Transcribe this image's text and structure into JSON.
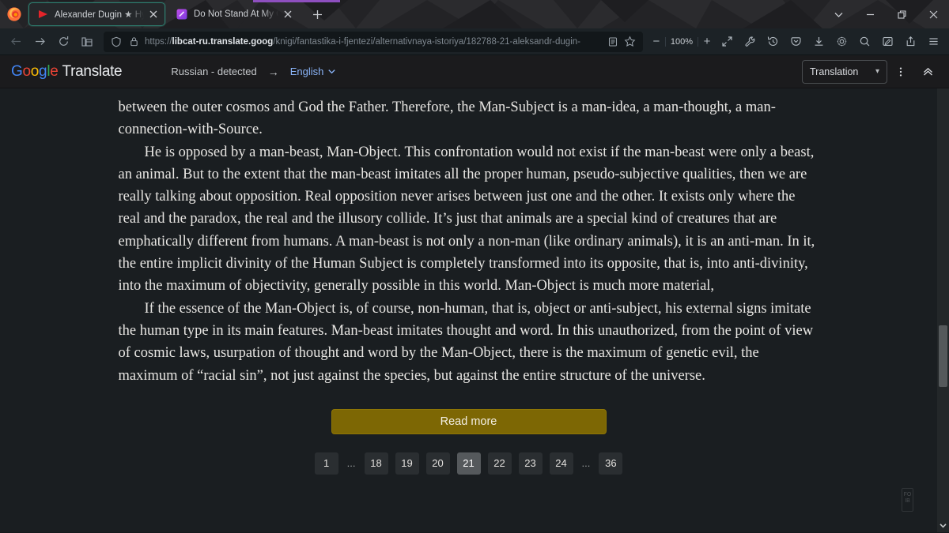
{
  "window": {
    "controls": {
      "list_tabs": "list-all-tabs",
      "minimize": "minimize",
      "maximize": "restore",
      "close": "close"
    }
  },
  "tabs": [
    {
      "title": "Alexander Dugin ★ Hyperborea",
      "favicon": "red-triangle-icon",
      "active": true,
      "close_label": "✕"
    },
    {
      "title": "Do Not Stand At My Grave And",
      "favicon": "purple-square-icon",
      "active": false,
      "close_label": "✕"
    }
  ],
  "newtab": {
    "label": "+",
    "tooltip": "New tab"
  },
  "navbar": {
    "back": "back-arrow",
    "forward": "forward-arrow",
    "reload": "reload-icon",
    "library": "library-icon",
    "url": {
      "scheme": "https://",
      "domain": "libcat-ru.translate.goog",
      "path": "/knigi/fantastika-i-fjentezi/alternativnaya-istoriya/182788-21-aleksandr-dugin-",
      "full": "https://libcat-ru.translate.goog/knigi/fantastika-i-fjentezi/alternativnaya-istoriya/182788-21-aleksandr-dugin-"
    },
    "shield": "shield-icon",
    "lock": "lock-icon",
    "reader": "reader-view-icon",
    "bookmark": "star-icon",
    "zoom_out": "−",
    "zoom_level": "100%",
    "zoom_in": "+",
    "icons": [
      "fullscreen-expand-icon",
      "wrench-icon",
      "history-icon",
      "pocket-icon",
      "download-icon",
      "gear-icon",
      "search-icon",
      "annotate-icon",
      "share-icon",
      "hamburger-menu-icon"
    ]
  },
  "translate_bar": {
    "logo": {
      "google": "Google",
      "translate": "Translate"
    },
    "source_lang": "Russian - detected",
    "arrow": "→",
    "target_lang": "English",
    "chevron": "chevron-down-icon",
    "mode_select": {
      "value": "Translation",
      "chevron": "▾"
    },
    "more_menu": "kebab-menu-icon",
    "collapse": "collapse-chevron-icon"
  },
  "main": {
    "paragraphs": [
      {
        "indent": false,
        "text": "between the outer cosmos and God the Father. Therefore, the Man-Subject is a man-idea, a man-thought, a man-connection-with-Source."
      },
      {
        "indent": true,
        "text": "He is opposed by a man-beast, Man-Object. This confrontation would not exist if the man-beast were only a beast, an animal. But to the extent that the man-beast imitates all the proper human, pseudo-subjective qualities, then we are really talking about opposition. Real opposition never arises between just one and the other. It exists only where the real and the paradox, the real and the illusory collide. It’s just that animals are a special kind of creatures that are emphatically different from humans. A man-beast is not only a non-man (like ordinary animals), it is an anti-man. In it, the entire implicit divinity of the Human Subject is completely transformed into its opposite, that is, into anti-divinity, into the maximum of objectivity, generally possible in this world. Man-Object is much more material,"
      },
      {
        "indent": true,
        "text": "If the essence of the Man-Object is, of course, non-human, that is, object or anti-subject, his external signs imitate the human type in its main features. Man-beast imitates thought and word. In this unauthorized, from the point of view of cosmic laws, usurpation of thought and word by the Man-Object, there is the maximum of genetic evil, the maximum of “racial sin”, not just against the species, but against the entire structure of the universe."
      }
    ],
    "read_more_button": "Read more",
    "pagination": [
      {
        "label": "1",
        "current": false,
        "gap": false
      },
      {
        "label": "...",
        "current": false,
        "gap": true
      },
      {
        "label": "18",
        "current": false,
        "gap": false
      },
      {
        "label": "19",
        "current": false,
        "gap": false
      },
      {
        "label": "20",
        "current": false,
        "gap": false
      },
      {
        "label": "21",
        "current": true,
        "gap": false
      },
      {
        "label": "22",
        "current": false,
        "gap": false
      },
      {
        "label": "23",
        "current": false,
        "gap": false
      },
      {
        "label": "24",
        "current": false,
        "gap": false
      },
      {
        "label": "...",
        "current": false,
        "gap": true
      },
      {
        "label": "36",
        "current": false,
        "gap": false
      }
    ],
    "corner_widget": "FO IB"
  },
  "scrollbar": {
    "down_arrow": "scroll-down-arrow"
  },
  "colors": {
    "accent_tab_border": "#2e7d6e",
    "read_more_bg": "#7d6704",
    "link_blue": "#8ab4f8",
    "page_bg": "#1a1e21",
    "text": "#e8e6e3",
    "pager_bg": "#2a2e31",
    "pager_active_bg": "#55595c"
  }
}
